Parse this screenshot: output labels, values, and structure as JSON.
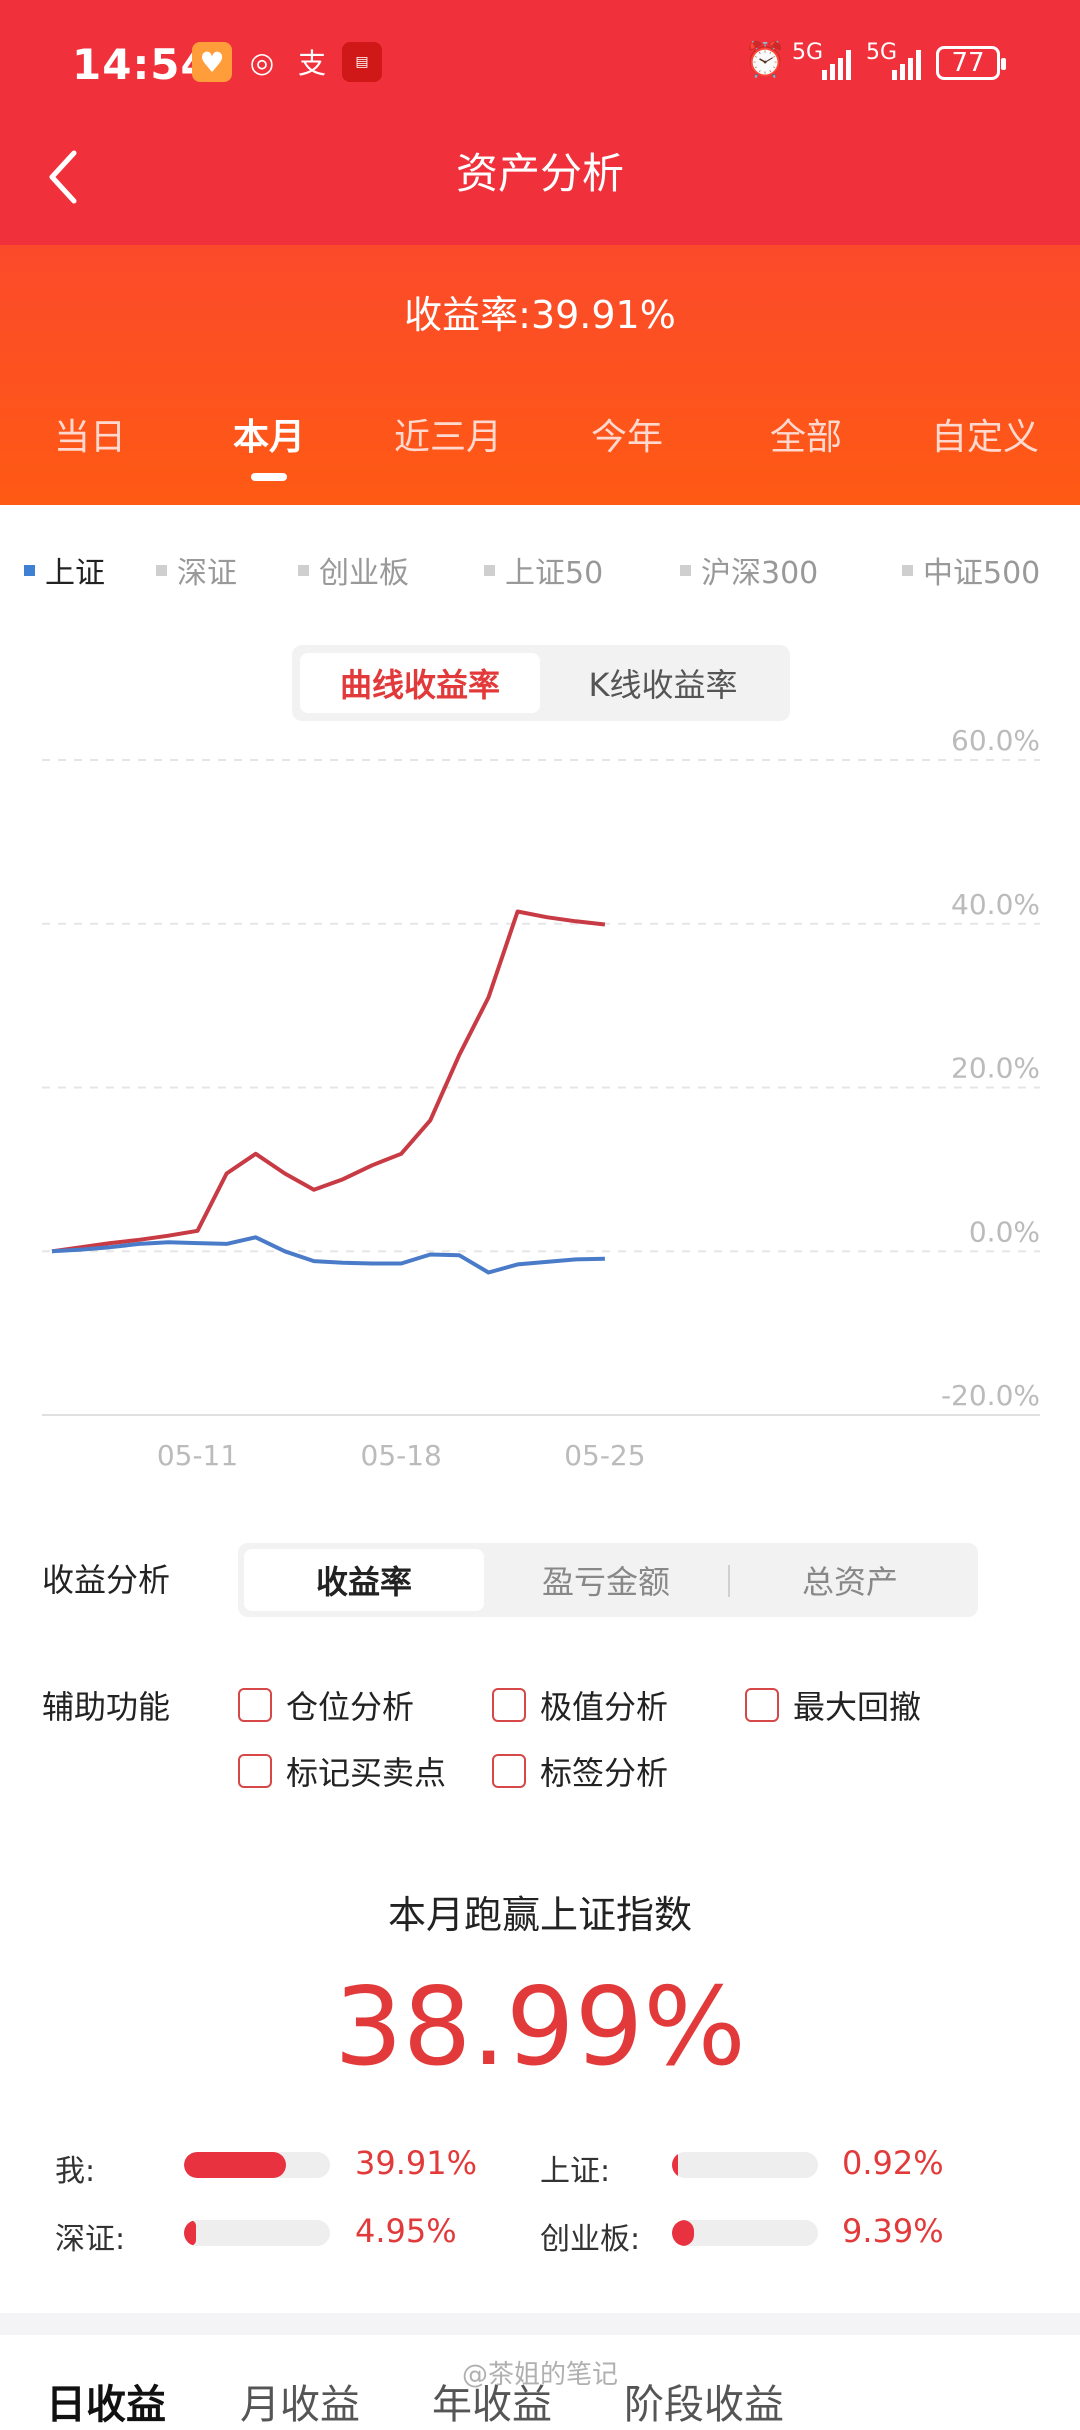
{
  "status_bar": {
    "time": "14:54",
    "network1": "5G",
    "network2": "5G",
    "battery": "77",
    "app_icons": [
      "heart-app-icon",
      "weibo-icon",
      "alipay-icon",
      "news-app-icon"
    ]
  },
  "header": {
    "title": "资产分析",
    "yield_text": "收益率:39.91%",
    "tabs": [
      "当日",
      "本月",
      "近三月",
      "今年",
      "全部",
      "自定义"
    ],
    "active_tab": "本月"
  },
  "indices": [
    "上证",
    "深证",
    "创业板",
    "上证50",
    "沪深300",
    "中证500"
  ],
  "active_index": "上证",
  "chart_toggle": {
    "options": [
      "曲线收益率",
      "K线收益率"
    ],
    "active": "曲线收益率"
  },
  "chart_data": {
    "type": "line",
    "x": [
      "05-06",
      "05-07",
      "05-08",
      "05-09",
      "05-10",
      "05-11",
      "05-12",
      "05-13",
      "05-14",
      "05-15",
      "05-16",
      "05-17",
      "05-18",
      "05-19",
      "05-20",
      "05-21",
      "05-22",
      "05-23",
      "05-24",
      "05-25"
    ],
    "xticks": [
      "05-11",
      "05-18",
      "05-25"
    ],
    "yticks": [
      "60.0%",
      "40.0%",
      "20.0%",
      "0.0%",
      "-20.0%"
    ],
    "ylim": [
      -20,
      60
    ],
    "series": [
      {
        "color": "#c83a44",
        "values": [
          0,
          0.5,
          1.0,
          1.4,
          1.9,
          2.5,
          9.5,
          11.9,
          9.5,
          7.5,
          8.8,
          10.5,
          11.9,
          16.0,
          24.0,
          31.0,
          41.5,
          40.8,
          40.3,
          39.91
        ]
      },
      {
        "color": "#4a7bc8",
        "values": [
          0,
          0.2,
          0.5,
          0.9,
          1.1,
          1.0,
          0.9,
          1.7,
          0.0,
          -1.2,
          -1.4,
          -1.5,
          -1.5,
          -0.4,
          -0.5,
          -2.6,
          -1.6,
          -1.3,
          -1.0,
          -0.92
        ]
      }
    ]
  },
  "analysis": {
    "label": "收益分析",
    "options": [
      "收益率",
      "盈亏金额",
      "总资产"
    ],
    "active": "收益率"
  },
  "aux": {
    "label": "辅助功能",
    "options": [
      "仓位分析",
      "极值分析",
      "最大回撤",
      "标记买卖点",
      "标签分析"
    ]
  },
  "beat": {
    "title": "本月跑赢上证指数",
    "value": "38.99%"
  },
  "compare": [
    {
      "label": "我:",
      "value": "39.91%",
      "fill": 0.7
    },
    {
      "label": "上证:",
      "value": "0.92%",
      "fill": 0.02
    },
    {
      "label": "深证:",
      "value": "4.95%",
      "fill": 0.08
    },
    {
      "label": "创业板:",
      "value": "9.39%",
      "fill": 0.15
    }
  ],
  "bottom_tabs": [
    "日收益",
    "月收益",
    "年收益",
    "阶段收益"
  ],
  "watermark": "@茶姐的笔记"
}
